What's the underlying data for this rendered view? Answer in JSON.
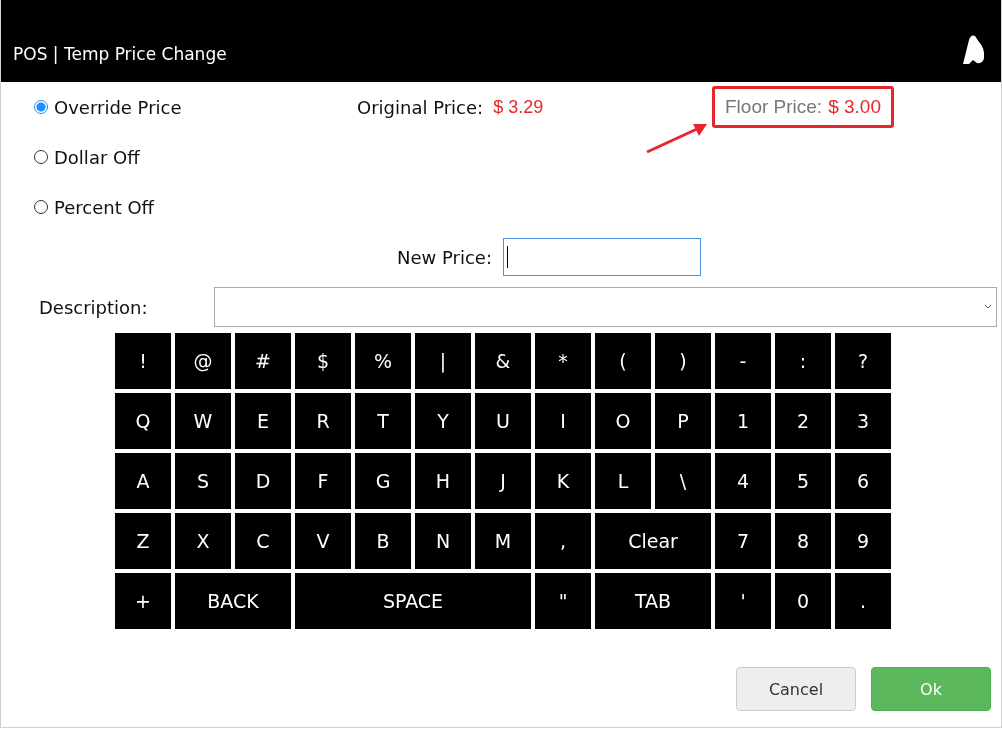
{
  "window": {
    "title": "POS | Temp Price Change"
  },
  "options": [
    {
      "label": "Override Price",
      "selected": true
    },
    {
      "label": "Dollar Off",
      "selected": false
    },
    {
      "label": "Percent Off",
      "selected": false
    }
  ],
  "original_price": {
    "label": "Original Price:",
    "value": "$ 3.29"
  },
  "floor_price": {
    "label": "Floor Price:",
    "value": "$ 3.00",
    "highlighted": true
  },
  "new_price": {
    "label": "New Price:",
    "focused": true
  },
  "description": {
    "label": "Description:"
  },
  "keyboard": {
    "rows": [
      {
        "keys": [
          {
            "label": "!",
            "kind": "key"
          },
          {
            "label": "@",
            "kind": "key"
          },
          {
            "label": "#",
            "kind": "key"
          },
          {
            "label": "$",
            "kind": "key"
          },
          {
            "label": "%",
            "kind": "key"
          },
          {
            "label": "|",
            "kind": "key"
          },
          {
            "label": "&",
            "kind": "key"
          },
          {
            "label": "*",
            "kind": "key"
          },
          {
            "label": "(",
            "kind": "key"
          },
          {
            "label": ")",
            "kind": "key"
          },
          {
            "label": "-",
            "kind": "key"
          },
          {
            "label": ":",
            "kind": "key"
          },
          {
            "label": "?",
            "kind": "key"
          }
        ]
      },
      {
        "keys": [
          {
            "label": "Q",
            "kind": "key"
          },
          {
            "label": "W",
            "kind": "key"
          },
          {
            "label": "E",
            "kind": "key"
          },
          {
            "label": "R",
            "kind": "key"
          },
          {
            "label": "T",
            "kind": "key"
          },
          {
            "label": "Y",
            "kind": "key"
          },
          {
            "label": "U",
            "kind": "key"
          },
          {
            "label": "I",
            "kind": "key"
          },
          {
            "label": "O",
            "kind": "key"
          },
          {
            "label": "P",
            "kind": "key"
          },
          {
            "label": "1",
            "kind": "key"
          },
          {
            "label": "2",
            "kind": "key"
          },
          {
            "label": "3",
            "kind": "key"
          }
        ]
      },
      {
        "keys": [
          {
            "label": "A",
            "kind": "key"
          },
          {
            "label": "S",
            "kind": "key"
          },
          {
            "label": "D",
            "kind": "key"
          },
          {
            "label": "F",
            "kind": "key"
          },
          {
            "label": "G",
            "kind": "key"
          },
          {
            "label": "H",
            "kind": "key"
          },
          {
            "label": "J",
            "kind": "key"
          },
          {
            "label": "K",
            "kind": "key"
          },
          {
            "label": "L",
            "kind": "key"
          },
          {
            "label": "\\",
            "kind": "key"
          },
          {
            "label": "4",
            "kind": "key"
          },
          {
            "label": "5",
            "kind": "key"
          },
          {
            "label": "6",
            "kind": "key"
          }
        ]
      },
      {
        "keys": [
          {
            "label": "Z",
            "kind": "key"
          },
          {
            "label": "X",
            "kind": "key"
          },
          {
            "label": "C",
            "kind": "key"
          },
          {
            "label": "V",
            "kind": "key"
          },
          {
            "label": "B",
            "kind": "key"
          },
          {
            "label": "N",
            "kind": "key"
          },
          {
            "label": "M",
            "kind": "key"
          },
          {
            "label": ",",
            "kind": "key"
          },
          {
            "label": "Clear",
            "kind": "wide"
          },
          {
            "label": "7",
            "kind": "key"
          },
          {
            "label": "8",
            "kind": "key"
          },
          {
            "label": "9",
            "kind": "key"
          }
        ]
      },
      {
        "keys": [
          {
            "label": "+",
            "kind": "key"
          },
          {
            "label": "BACK",
            "kind": "wide"
          },
          {
            "label": "SPACE",
            "kind": "space"
          },
          {
            "label": "\"",
            "kind": "key"
          },
          {
            "label": "TAB",
            "kind": "wide"
          },
          {
            "label": "'",
            "kind": "key"
          },
          {
            "label": "0",
            "kind": "key"
          },
          {
            "label": ".",
            "kind": "key"
          }
        ]
      }
    ]
  },
  "buttons": [
    {
      "label": "Cancel",
      "kind": "secondary"
    },
    {
      "label": "Ok",
      "kind": "primary"
    }
  ]
}
